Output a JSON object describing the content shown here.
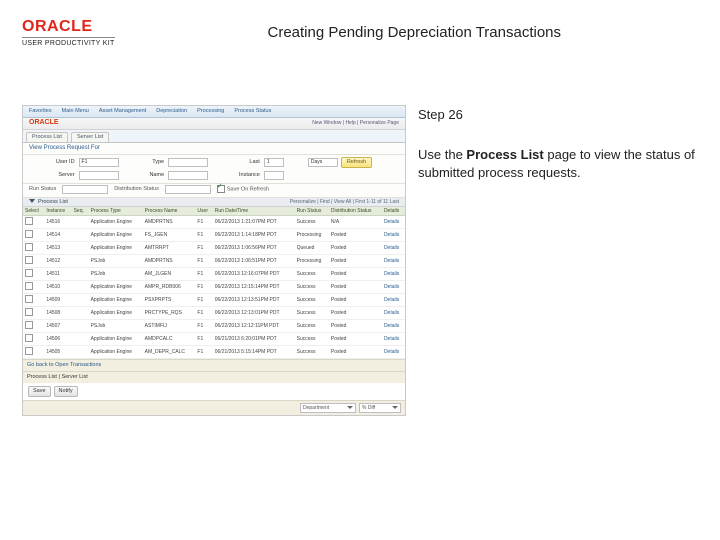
{
  "brand": {
    "name": "ORACLE",
    "subtitle": "USER PRODUCTIVITY KIT"
  },
  "page_title": "Creating Pending Depreciation Transactions",
  "step": {
    "label": "Step 26"
  },
  "instruction": {
    "pre": "Use the ",
    "bold": "Process List",
    "post": " page to view the status of submitted process requests."
  },
  "mini": {
    "menu": [
      "Favorites",
      "Main Menu",
      "Asset Management",
      "Depreciation",
      "Processing",
      "Process Status"
    ],
    "brand": "ORACLE",
    "brand_right": "New Window | Help | Personalize Page",
    "tabs": [
      "Process List",
      "Server List"
    ],
    "section_title": "View Process Request For",
    "filters": {
      "user_id_label": "User ID",
      "user_id_value": "F1",
      "type_label": "Type",
      "type_value": "",
      "last_label": "Last",
      "last_value": "1",
      "last_unit": "Days",
      "refresh": "Refresh",
      "server_label": "Server",
      "server_value": "",
      "name_label": "Name",
      "name_value": "",
      "instance_label": "Instance",
      "instance_value": "",
      "run_status_label": "Run Status",
      "run_status_value": "",
      "dist_status_label": "Distribution Status",
      "dist_status_value": "",
      "save_on_refresh": "Save On Refresh"
    },
    "list_bar": {
      "title": "Process List",
      "right": "Personalize | Find | View All | First 1-11 of 11 Last"
    },
    "columns": [
      "Select",
      "Instance",
      "Seq.",
      "Process Type",
      "Process Name",
      "User",
      "Run Date/Time",
      "Run Status",
      "Distribution Status",
      "Details"
    ],
    "rows": [
      {
        "inst": "14516",
        "seq": "",
        "ptype": "Application Engine",
        "pname": "AMDPRTNS",
        "user": "F1",
        "dt": "06/22/2013 1:21:07PM PDT",
        "rs": "Success",
        "ds": "N/A",
        "det": "Details"
      },
      {
        "inst": "14514",
        "seq": "",
        "ptype": "Application Engine",
        "pname": "FS_JGEN",
        "user": "F1",
        "dt": "06/22/2013 1:14:18PM PDT",
        "rs": "Processing",
        "ds": "Posted",
        "det": "Details"
      },
      {
        "inst": "14513",
        "seq": "",
        "ptype": "Application Engine",
        "pname": "AMTRRPT",
        "user": "F1",
        "dt": "06/22/2013 1:06:56PM PDT",
        "rs": "Queued",
        "ds": "Posted",
        "det": "Details"
      },
      {
        "inst": "14512",
        "seq": "",
        "ptype": "PSJob",
        "pname": "AMDPRTNS",
        "user": "F1",
        "dt": "06/22/2013 1:06:51PM PDT",
        "rs": "Processing",
        "ds": "Posted",
        "det": "Details"
      },
      {
        "inst": "14511",
        "seq": "",
        "ptype": "PSJob",
        "pname": "AM_JLGEN",
        "user": "F1",
        "dt": "06/22/2013 12:16:07PM PDT",
        "rs": "Success",
        "ds": "Posted",
        "det": "Details"
      },
      {
        "inst": "14510",
        "seq": "",
        "ptype": "Application Engine",
        "pname": "AMPR_RDB006",
        "user": "F1",
        "dt": "06/22/2013 12:15:14PM PDT",
        "rs": "Success",
        "ds": "Posted",
        "det": "Details"
      },
      {
        "inst": "14509",
        "seq": "",
        "ptype": "Application Engine",
        "pname": "PSXPRPTS",
        "user": "F1",
        "dt": "06/22/2013 12:13:51PM PDT",
        "rs": "Success",
        "ds": "Posted",
        "det": "Details"
      },
      {
        "inst": "14508",
        "seq": "",
        "ptype": "Application Engine",
        "pname": "PRCTYPE_RQS",
        "user": "F1",
        "dt": "06/22/2013 12:13:01PM PDT",
        "rs": "Success",
        "ds": "Posted",
        "det": "Details"
      },
      {
        "inst": "14507",
        "seq": "",
        "ptype": "PSJob",
        "pname": "ASTIMFIJ",
        "user": "F1",
        "dt": "06/22/2013 12:12:11PM PDT",
        "rs": "Success",
        "ds": "Posted",
        "det": "Details"
      },
      {
        "inst": "14506",
        "seq": "",
        "ptype": "Application Engine",
        "pname": "AMDPCALC",
        "user": "F1",
        "dt": "06/21/2013 6:20:01PM PDT",
        "rs": "Success",
        "ds": "Posted",
        "det": "Details"
      },
      {
        "inst": "14505",
        "seq": "",
        "ptype": "Application Engine",
        "pname": "AM_DEPR_CALC",
        "user": "F1",
        "dt": "06/21/2013 5:15:14PM PDT",
        "rs": "Success",
        "ds": "Posted",
        "det": "Details"
      }
    ],
    "footer_links": "Go back to Open Transactions",
    "sub_section": "Process List | Server List",
    "save_btn": "Save",
    "notify_btn": "Notify",
    "bottom": {
      "dd1": "Department",
      "dd2": "% Diff"
    }
  }
}
